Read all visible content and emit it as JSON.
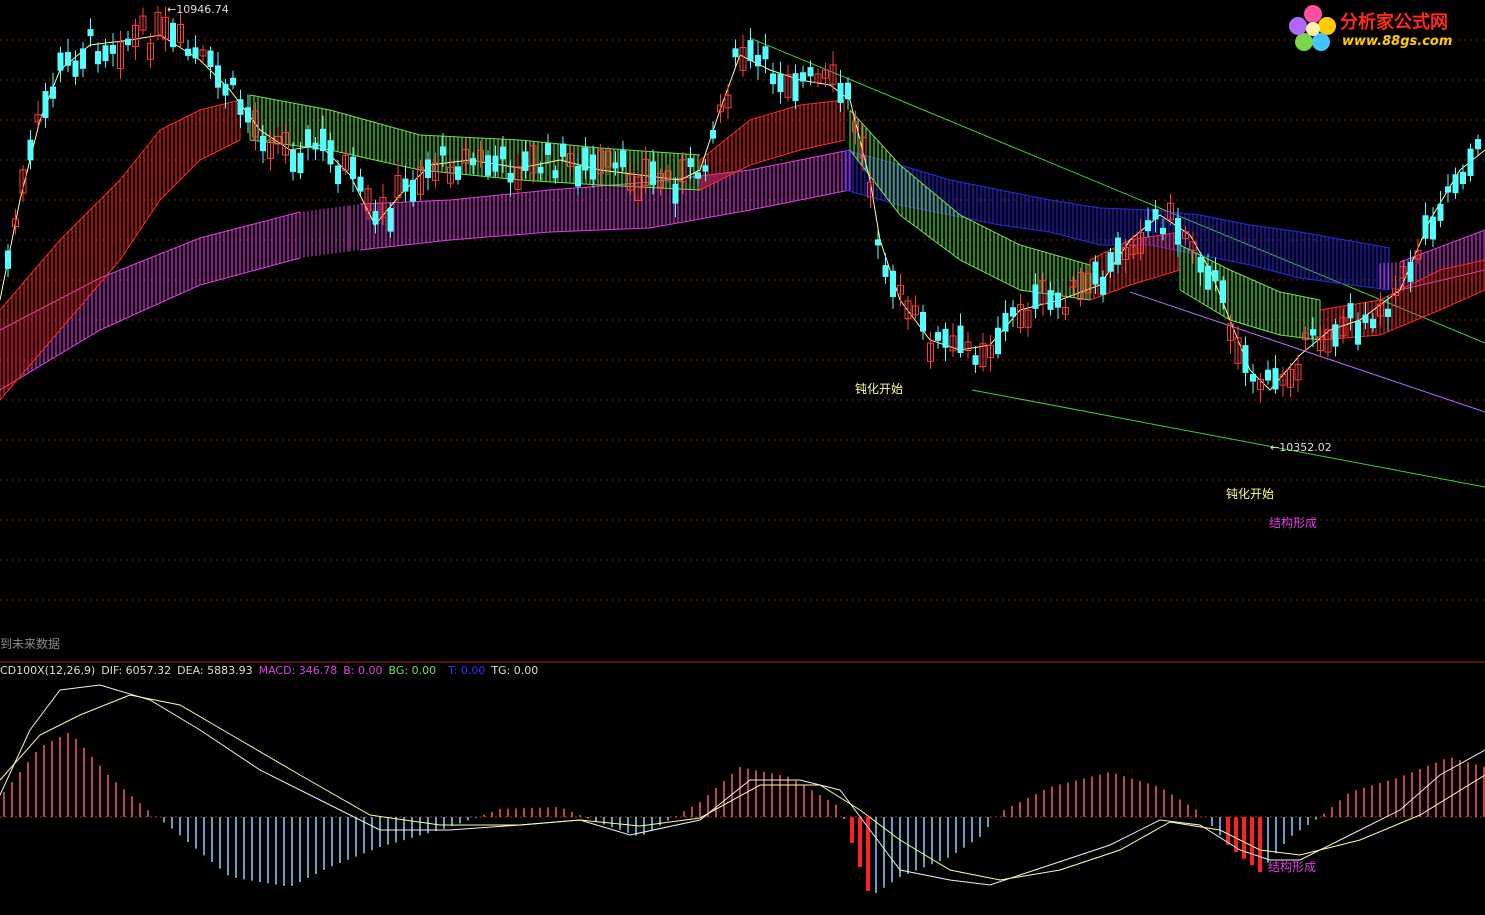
{
  "logo": {
    "name": "分析家公式网",
    "url": "www.88gs.com"
  },
  "price_panel": {
    "high_label": "10946.74",
    "low_label": "10352.02",
    "annotations": [
      "钝化开始",
      "钝化开始",
      "结构形成"
    ],
    "future_data_label": "到未来数据"
  },
  "macd_panel": {
    "name": "CD100X(12,26,9)",
    "dif": "DIF: 6057.32",
    "dea": "DEA: 5883.93",
    "macd": "MACD: 346.78",
    "b": "B: 0.00",
    "bg": "BG: 0.00",
    "t": "T: 0.00",
    "tg": "TG: 0.00",
    "annotation": "结构形成"
  },
  "colors": {
    "background": "#000000",
    "candle_up": "#ff3b3b",
    "candle_down": "#54ffff",
    "ma_line": "#ffff99",
    "band_red": "#ff2a2a",
    "band_green": "#6be34a",
    "band_blue": "#2a2ae0",
    "band_magenta": "#e040e0",
    "trend_green": "#3ecf3e",
    "trend_purple": "#b070ff",
    "grid": "#7a1c1c",
    "macd_pos": "#ff5a5a",
    "macd_neg": "#7fd4ff"
  }
}
